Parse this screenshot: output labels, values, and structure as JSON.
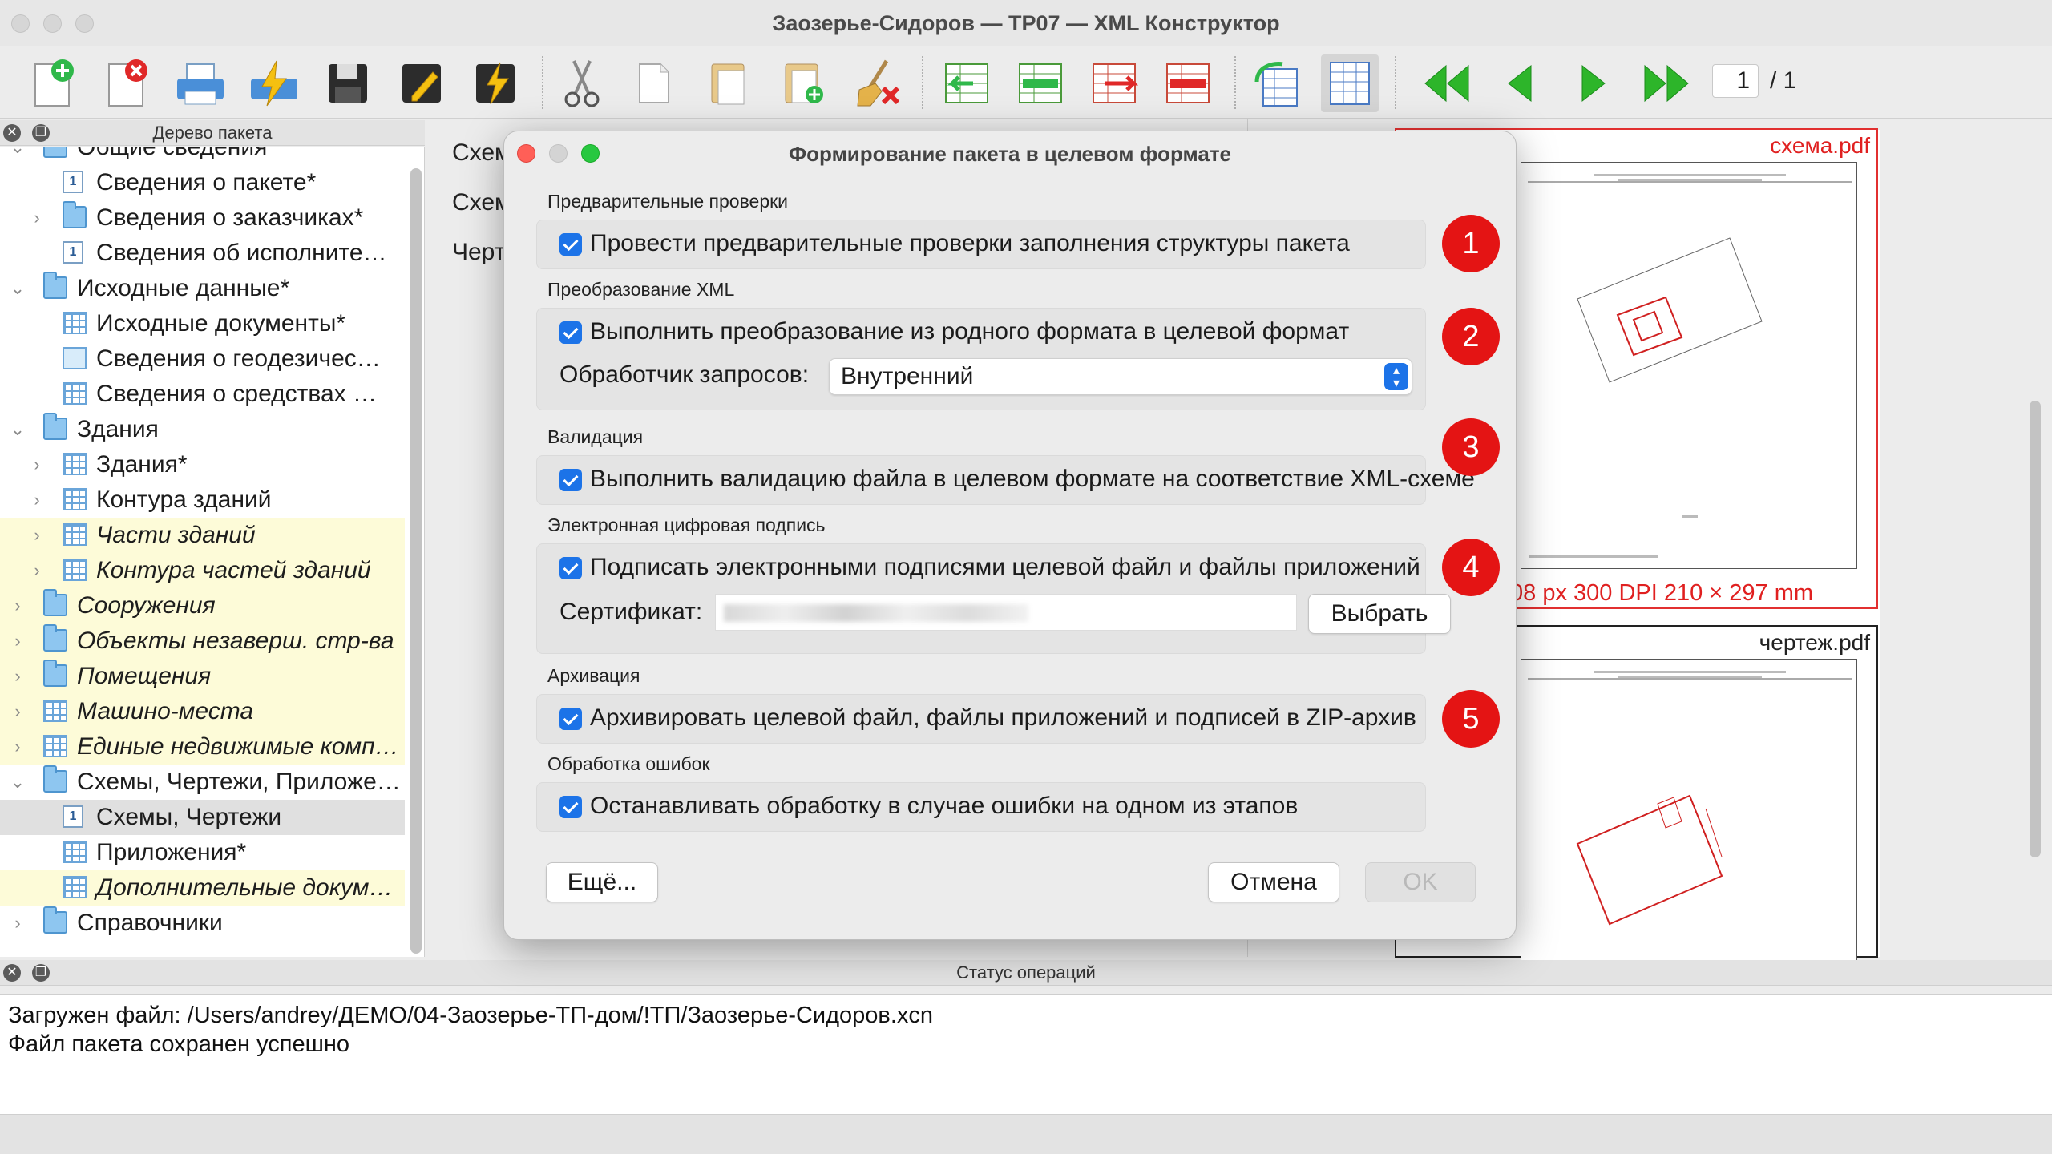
{
  "window": {
    "title": "Заозерье-Сидоров — ТР07 — XML Конструктор"
  },
  "toolbar": {
    "page_current": "1",
    "page_total": "/ 1",
    "buttons": [
      "new-doc",
      "delete-doc",
      "print",
      "flash",
      "save",
      "edit-save",
      "flash-save",
      "cut",
      "copy",
      "paste",
      "paste-add",
      "clear",
      "add-row-left",
      "insert-row",
      "add-row-right",
      "remove-row",
      "copy-table",
      "table-view",
      "first-page",
      "prev-page",
      "next-page",
      "last-page"
    ]
  },
  "tree_panel": {
    "header": "Дерево пакета",
    "items": [
      {
        "label": "Общие сведения*",
        "level": 0,
        "chev": "⌄",
        "icon": "folder",
        "italic": false,
        "highlight": false
      },
      {
        "label": "Сведения о пакете*",
        "level": 1,
        "chev": "",
        "icon": "doc1",
        "italic": false,
        "highlight": false
      },
      {
        "label": "Сведения о заказчиках*",
        "level": 1,
        "chev": "›",
        "icon": "folder",
        "italic": false,
        "highlight": false
      },
      {
        "label": "Сведения об исполните…",
        "level": 1,
        "chev": "",
        "icon": "doc1",
        "italic": false,
        "highlight": false
      },
      {
        "label": "Исходные данные*",
        "level": 0,
        "chev": "⌄",
        "icon": "folder",
        "italic": false,
        "highlight": false
      },
      {
        "label": "Исходные документы*",
        "level": 1,
        "chev": "",
        "icon": "grid",
        "italic": false,
        "highlight": false
      },
      {
        "label": "Сведения о геодезичес…",
        "level": 1,
        "chev": "",
        "icon": "house",
        "italic": false,
        "highlight": false
      },
      {
        "label": "Сведения о средствах …",
        "level": 1,
        "chev": "",
        "icon": "grid",
        "italic": false,
        "highlight": false
      },
      {
        "label": "Здания",
        "level": 0,
        "chev": "⌄",
        "icon": "folder",
        "italic": false,
        "highlight": false
      },
      {
        "label": "Здания*",
        "level": 1,
        "chev": "›",
        "icon": "grid",
        "italic": false,
        "highlight": false
      },
      {
        "label": "Контура зданий",
        "level": 1,
        "chev": "›",
        "icon": "grid",
        "italic": false,
        "highlight": false
      },
      {
        "label": "Части зданий",
        "level": 1,
        "chev": "›",
        "icon": "grid",
        "italic": true,
        "highlight": true
      },
      {
        "label": "Контура частей зданий",
        "level": 1,
        "chev": "›",
        "icon": "grid",
        "italic": true,
        "highlight": true
      },
      {
        "label": "Сооружения",
        "level": 0,
        "chev": "›",
        "icon": "folder",
        "italic": true,
        "highlight": true
      },
      {
        "label": "Объекты незаверш. стр-ва",
        "level": 0,
        "chev": "›",
        "icon": "folder",
        "italic": true,
        "highlight": true
      },
      {
        "label": "Помещения",
        "level": 0,
        "chev": "›",
        "icon": "folder",
        "italic": true,
        "highlight": true
      },
      {
        "label": "Машино-места",
        "level": 0,
        "chev": "›",
        "icon": "grid",
        "italic": true,
        "highlight": true
      },
      {
        "label": "Единые недвижимые комп…",
        "level": 0,
        "chev": "›",
        "icon": "grid",
        "italic": true,
        "highlight": true
      },
      {
        "label": "Схемы, Чертежи, Приложе…",
        "level": 0,
        "chev": "⌄",
        "icon": "folder",
        "italic": false,
        "highlight": false
      },
      {
        "label": "Схемы, Чертежи",
        "level": 1,
        "chev": "",
        "icon": "doc1",
        "italic": false,
        "highlight": false,
        "selected": true
      },
      {
        "label": "Приложения*",
        "level": 1,
        "chev": "",
        "icon": "grid",
        "italic": false,
        "highlight": false
      },
      {
        "label": "Дополнительные докум…",
        "level": 1,
        "chev": "",
        "icon": "grid",
        "italic": true,
        "highlight": true
      },
      {
        "label": "Справочники",
        "level": 0,
        "chev": "›",
        "icon": "folder",
        "italic": false,
        "highlight": false
      }
    ]
  },
  "middle_panel": {
    "rows": [
      "Схем",
      "Схем",
      "Черт"
    ]
  },
  "preview": {
    "files": [
      {
        "name": "схема.pdf"
      },
      {
        "name": "чертеж.pdf"
      }
    ],
    "meta": "08 px    300 DPI      210 × 297 mm"
  },
  "status_panel": {
    "header": "Статус операций",
    "lines": [
      "Загружен файл: /Users/andrey/ДЕМО/04-Заозерье-ТП-дом/!ТП/Заозерье-Сидоров.xcn",
      "Файл пакета сохранен успешно"
    ]
  },
  "dialog": {
    "title": "Формирование пакета в целевом формате",
    "sections": {
      "precheck": {
        "title": "Предварительные проверки",
        "checkbox": "Провести предварительные проверки заполнения структуры пакета",
        "badge": "1"
      },
      "xml": {
        "title": "Преобразование XML",
        "checkbox": "Выполнить преобразование из родного формата в целевой формат",
        "handler_label": "Обработчик запросов:",
        "handler_value": "Внутренний",
        "badge": "2"
      },
      "validation": {
        "title": "Валидация",
        "checkbox": "Выполнить валидацию файла в целевом формате на соответствие XML-схеме",
        "badge": "3"
      },
      "signature": {
        "title": "Электронная цифровая подпись",
        "checkbox": "Подписать электронными подписями целевой файл и файлы приложений",
        "cert_label": "Сертификат:",
        "choose_button": "Выбрать",
        "badge": "4"
      },
      "archive": {
        "title": "Архивация",
        "checkbox": "Архивировать целевой файл, файлы приложений и подписей в ZIP-архив",
        "badge": "5"
      },
      "errors": {
        "title": "Обработка ошибок",
        "checkbox": "Останавливать обработку в случае ошибки на одном из этапов"
      }
    },
    "buttons": {
      "more": "Ещё...",
      "cancel": "Отмена",
      "ok": "OK"
    }
  }
}
